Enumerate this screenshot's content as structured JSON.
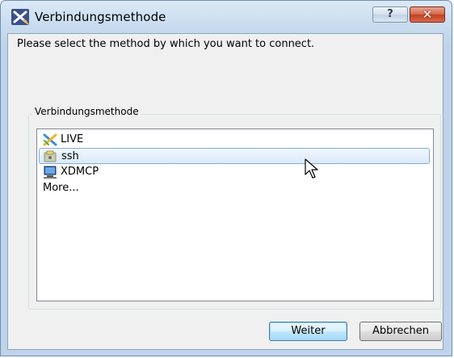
{
  "window": {
    "title": "Verbindungsmethode",
    "help_label": "?",
    "close_label": "✕"
  },
  "prompt": "Please select the method by which you want to connect.",
  "group": {
    "legend": "Verbindungsmethode",
    "items": [
      {
        "label": "LIVE",
        "icon": "live-x-icon",
        "selected": false
      },
      {
        "label": "ssh",
        "icon": "ssh-key-icon",
        "selected": true
      },
      {
        "label": "XDMCP",
        "icon": "monitor-icon",
        "selected": false
      },
      {
        "label": "More...",
        "icon": "",
        "selected": false
      }
    ]
  },
  "buttons": {
    "next_label": "Weiter",
    "cancel_label": "Abbrechen"
  },
  "colors": {
    "selection": "#dbeaf9",
    "title_bar": "#c9dcef",
    "close_button": "#c3401f"
  }
}
